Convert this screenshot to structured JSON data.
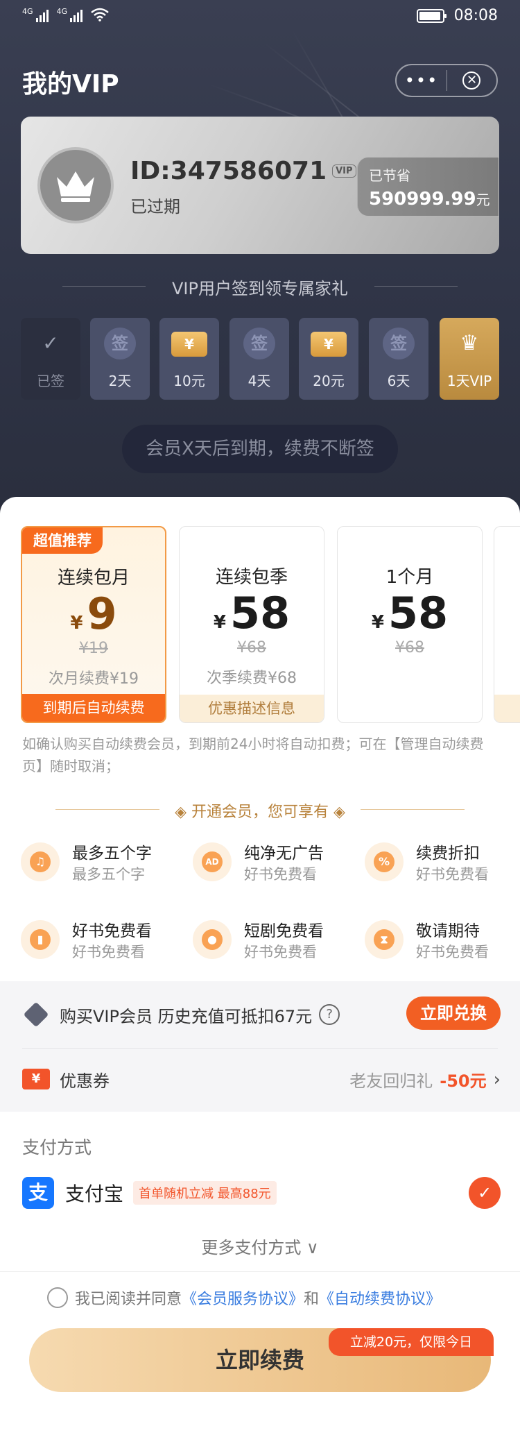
{
  "status_bar": {
    "signal1": "4G",
    "signal2": "4G",
    "time": "08:08"
  },
  "header": {
    "title": "我的VIP",
    "more_icon": "more-dots-icon",
    "close_icon": "close-circle-icon"
  },
  "member_card": {
    "user_id": "ID:347586071",
    "vip_badge": "VIP",
    "status": "已过期",
    "saved_label": "已节省",
    "saved_amount": "590999.99",
    "saved_unit": "元"
  },
  "checkin": {
    "title": "VIP用户签到领专属家礼",
    "days": [
      {
        "label": "已签",
        "icon": "check-icon",
        "glyph": "✓",
        "state": "signed"
      },
      {
        "label": "2天",
        "icon": "sign-icon",
        "glyph": "签",
        "state": "normal"
      },
      {
        "label": "10元",
        "icon": "ticket-icon",
        "glyph": "¥",
        "state": "normal"
      },
      {
        "label": "4天",
        "icon": "sign-icon",
        "glyph": "签",
        "state": "normal"
      },
      {
        "label": "20元",
        "icon": "ticket-icon",
        "glyph": "¥",
        "state": "normal"
      },
      {
        "label": "6天",
        "icon": "sign-icon",
        "glyph": "签",
        "state": "normal"
      },
      {
        "label": "1天VIP",
        "icon": "crown-icon",
        "glyph": "♛",
        "state": "gold"
      }
    ],
    "renew_tip": "会员X天后到期，续费不断签"
  },
  "plans": [
    {
      "badge": "超值推荐",
      "name": "连续包月",
      "currency": "¥",
      "price": "9",
      "original": "¥19",
      "next": "次月续费¥19",
      "footer": "到期后自动续费",
      "selected": true
    },
    {
      "badge": "",
      "name": "连续包季",
      "currency": "¥",
      "price": "58",
      "original": "¥68",
      "next": "次季续费¥68",
      "footer": "优惠描述信息",
      "selected": false
    },
    {
      "badge": "",
      "name": "1个月",
      "currency": "¥",
      "price": "58",
      "original": "¥68",
      "next": "",
      "footer": "",
      "selected": false
    }
  ],
  "notice": "如确认购买自动续费会员，到期前24小时将自动扣费；可在【管理自动续费页】随时取消；",
  "benefits": {
    "title": "开通会员，您可享有",
    "items": [
      {
        "title": "最多五个字",
        "subtitle": "最多五个字",
        "icon": "headphone-icon",
        "glyph": "♫"
      },
      {
        "title": "纯净无广告",
        "subtitle": "好书免费看",
        "icon": "no-ad-icon",
        "glyph": "AD"
      },
      {
        "title": "续费折扣",
        "subtitle": "好书免费看",
        "icon": "discount-icon",
        "glyph": "%"
      },
      {
        "title": "好书免费看",
        "subtitle": "好书免费看",
        "icon": "book-icon",
        "glyph": "▮"
      },
      {
        "title": "短剧免费看",
        "subtitle": "好书免费看",
        "icon": "film-icon",
        "glyph": "●"
      },
      {
        "title": "敬请期待",
        "subtitle": "好书免费看",
        "icon": "hourglass-icon",
        "glyph": "⧗"
      }
    ]
  },
  "exchange": {
    "text": "购买VIP会员 历史充值可抵扣67元",
    "help": "?",
    "button": "立即兑换"
  },
  "coupon": {
    "icon_glyph": "¥",
    "label": "优惠券",
    "desc": "老友回归礼",
    "amount": "-50元",
    "chevron": "›"
  },
  "payment": {
    "title": "支付方式",
    "method_glyph": "支",
    "method": "支付宝",
    "promo": "首单随机立减 最高88元",
    "check": "✓",
    "more": "更多支付方式 ∨"
  },
  "agreement": {
    "prefix": "我已阅读并同意",
    "link1": "《会员服务协议》",
    "and": "和",
    "link2": "《自动续费协议》"
  },
  "cta": {
    "label": "立即续费",
    "tag": "立减20元，仅限今日"
  }
}
